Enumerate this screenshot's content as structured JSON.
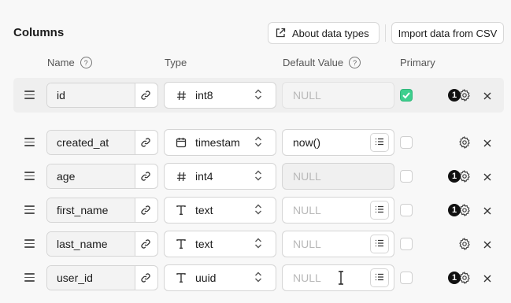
{
  "header": {
    "title": "Columns",
    "about_label": "About data types",
    "import_label": "Import data from CSV"
  },
  "columns_header": {
    "name": "Name",
    "type": "Type",
    "default_value": "Default Value",
    "primary": "Primary",
    "help_glyph": "?"
  },
  "rows": [
    {
      "name": "id",
      "type": "int8",
      "type_icon": "hash-icon",
      "default": "NULL",
      "default_is_placeholder": true,
      "has_default_menu": false,
      "primary": true,
      "badge": "1"
    },
    {
      "name": "created_at",
      "type": "timestam",
      "type_icon": "calendar-icon",
      "default": "now()",
      "default_is_placeholder": false,
      "has_default_menu": true,
      "primary": false,
      "badge": ""
    },
    {
      "name": "age",
      "type": "int4",
      "type_icon": "hash-icon",
      "default": "NULL",
      "default_is_placeholder": true,
      "has_default_menu": false,
      "primary": false,
      "badge": "1"
    },
    {
      "name": "first_name",
      "type": "text",
      "type_icon": "text-type-icon",
      "default": "NULL",
      "default_is_placeholder": true,
      "has_default_menu": true,
      "primary": false,
      "badge": "1"
    },
    {
      "name": "last_name",
      "type": "text",
      "type_icon": "text-type-icon",
      "default": "NULL",
      "default_is_placeholder": true,
      "has_default_menu": true,
      "primary": false,
      "badge": ""
    },
    {
      "name": "user_id",
      "type": "uuid",
      "type_icon": "text-type-icon",
      "default": "NULL",
      "default_is_placeholder": true,
      "has_default_menu": true,
      "primary": false,
      "badge": "1"
    }
  ],
  "colors": {
    "accent_green": "#3ecf8e",
    "background": "#f8f8f8"
  }
}
